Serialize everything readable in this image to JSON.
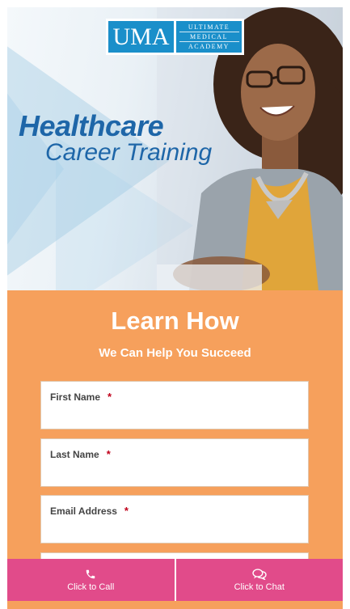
{
  "logo": {
    "mark": "UMA",
    "words": [
      "ULTIMATE",
      "MEDICAL",
      "ACADEMY"
    ]
  },
  "hero": {
    "line1": "Healthcare",
    "line2": "Career Training"
  },
  "form": {
    "title": "Learn How",
    "subtitle": "We Can Help You Succeed",
    "fields": [
      {
        "label": "First Name",
        "required_mark": "*",
        "value": ""
      },
      {
        "label": "Last Name",
        "required_mark": "*",
        "value": ""
      },
      {
        "label": "Email Address",
        "required_mark": "*",
        "value": ""
      }
    ]
  },
  "bottom_bar": {
    "call_label": "Click to Call",
    "call_icon": "phone-icon",
    "chat_label": "Click to Chat",
    "chat_icon": "chat-bubbles-icon"
  },
  "colors": {
    "brand_blue": "#1a8fca",
    "headline_blue": "#1e66a8",
    "form_bg": "#f6a05c",
    "action_pink": "#e14b8a"
  }
}
